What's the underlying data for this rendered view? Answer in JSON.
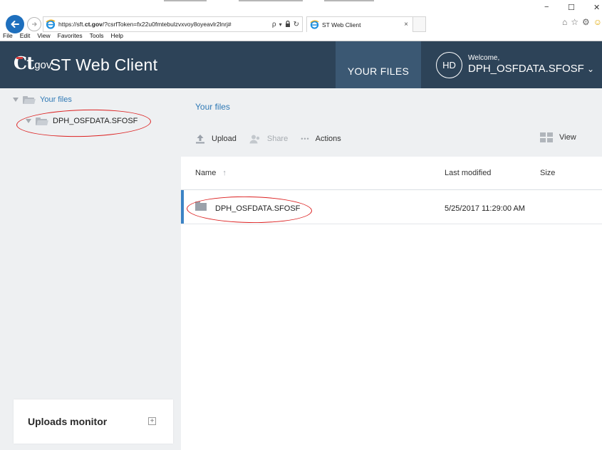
{
  "browser": {
    "url_prefix": "https://sft.",
    "url_domain": "ct.gov",
    "url_suffix": "/?csrfToken=fx22u0fmtebulzvxvoy8oyeavlr2lnrj#",
    "search_glyph": "ρ",
    "dropdown_glyph": "▾",
    "lock_glyph": "🔒",
    "refresh_glyph": "↻",
    "tab_label": "ST Web Client",
    "tab_close": "×",
    "menu": [
      "File",
      "Edit",
      "View",
      "Favorites",
      "Tools",
      "Help"
    ],
    "minimize": "−",
    "maximize": "☐",
    "close": "✕",
    "icons": [
      "home-icon",
      "star-icon",
      "gear-icon",
      "smiley-icon"
    ],
    "icon_glyphs": [
      "⌂",
      "☆",
      "⚙",
      "☺"
    ]
  },
  "app": {
    "logo_ct": "Ct",
    "logo_gov": "gov",
    "title": "ST Web Client",
    "nav_tab": "YOUR FILES",
    "user_initials": "HD",
    "welcome": "Welcome,",
    "user_name": "DPH_OSFDATA.SFOSF",
    "user_chevron": "⌄",
    "brand_color": "#2d4358",
    "active_tab_color": "#3b5873",
    "link_color": "#2f79b5"
  },
  "sidebar": {
    "root_label": "Your files",
    "child_label": "DPH_OSFDATA.SFOSF",
    "uploads_monitor": "Uploads monitor",
    "uploads_expand": "+"
  },
  "main": {
    "breadcrumb": "Your files",
    "upload": "Upload",
    "share": "Share",
    "actions": "Actions",
    "actions_glyph": "•••",
    "view": "View",
    "columns": {
      "name": "Name",
      "sort_glyph": "↑",
      "modified": "Last modified",
      "size": "Size"
    },
    "rows": [
      {
        "name": "DPH_OSFDATA.SFOSF",
        "modified": "5/25/2017 11:29:00 AM",
        "size": ""
      }
    ]
  },
  "annotations": {
    "color": "#dc1f1f"
  }
}
